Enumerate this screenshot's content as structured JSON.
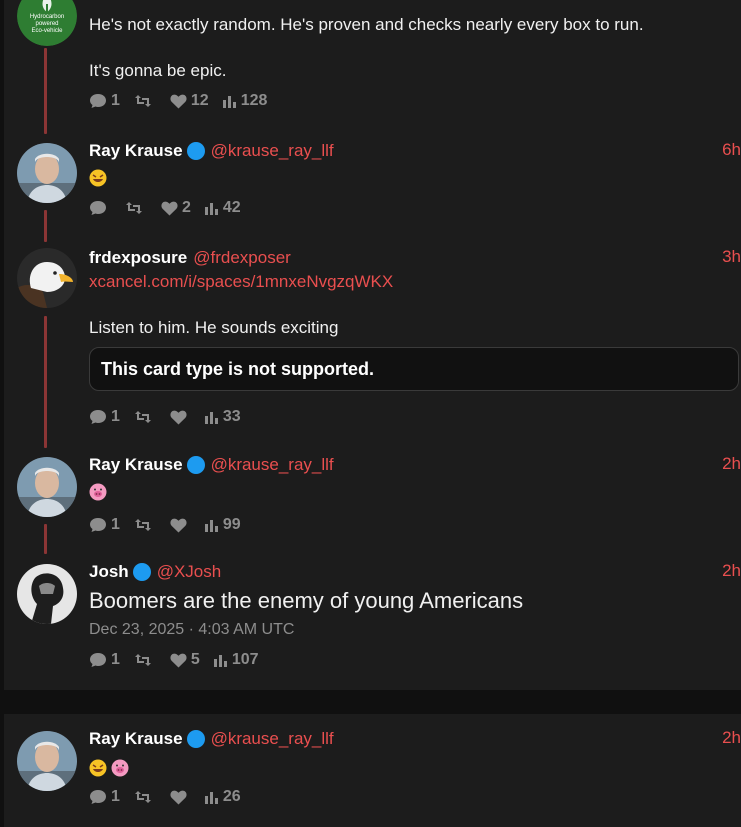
{
  "tweets": [
    {
      "avatar": "hydrocarbon-logo",
      "avatar_text": [
        "Hydrocarbon",
        "powered",
        "Eco-vehicle"
      ],
      "lines": [
        "He's not exactly random. He's proven and checks nearly every box to run.",
        "It's gonna be epic."
      ],
      "stats": {
        "replies": "1",
        "retweets": "",
        "likes": "12",
        "views": "128"
      }
    },
    {
      "fullname": "Ray Krause",
      "username": "@krause_ray_llf",
      "time": "6h",
      "verified": true,
      "emojis": [
        "rofl-emoji"
      ],
      "stats": {
        "replies": "",
        "retweets": "",
        "likes": "2",
        "views": "42"
      }
    },
    {
      "fullname": "frdexposure",
      "username": "@frdexposer",
      "time": "3h",
      "verified": false,
      "link": "xcancel.com/i/spaces/1mnxeNvgzqWKX",
      "text": "Listen to him. He sounds exciting",
      "card_message": "This card type is not supported.",
      "stats": {
        "replies": "1",
        "retweets": "",
        "likes": "",
        "views": "33"
      }
    },
    {
      "fullname": "Ray Krause",
      "username": "@krause_ray_llf",
      "time": "2h",
      "verified": true,
      "emojis": [
        "pig-emoji"
      ],
      "stats": {
        "replies": "1",
        "retweets": "",
        "likes": "",
        "views": "99"
      }
    },
    {
      "fullname": "Josh",
      "username": "@XJosh",
      "time": "2h",
      "verified": true,
      "text": "Boomers are the enemy of young Americans",
      "date": "Dec 23, 2025 · 4:03 AM UTC",
      "stats": {
        "replies": "1",
        "retweets": "",
        "likes": "5",
        "views": "107"
      }
    },
    {
      "fullname": "Ray Krause",
      "username": "@krause_ray_llf",
      "time": "2h",
      "verified": true,
      "emojis": [
        "rofl-emoji",
        "pig-emoji"
      ],
      "stats": {
        "replies": "1",
        "retweets": "",
        "likes": "",
        "views": "26"
      }
    }
  ],
  "colors": {
    "background": "#101010",
    "card": "#1c1c1c",
    "accent": "#e94f4f",
    "thread_line": "#8b3535",
    "verified": "#1d9bf0",
    "muted": "#8d8d8d"
  }
}
